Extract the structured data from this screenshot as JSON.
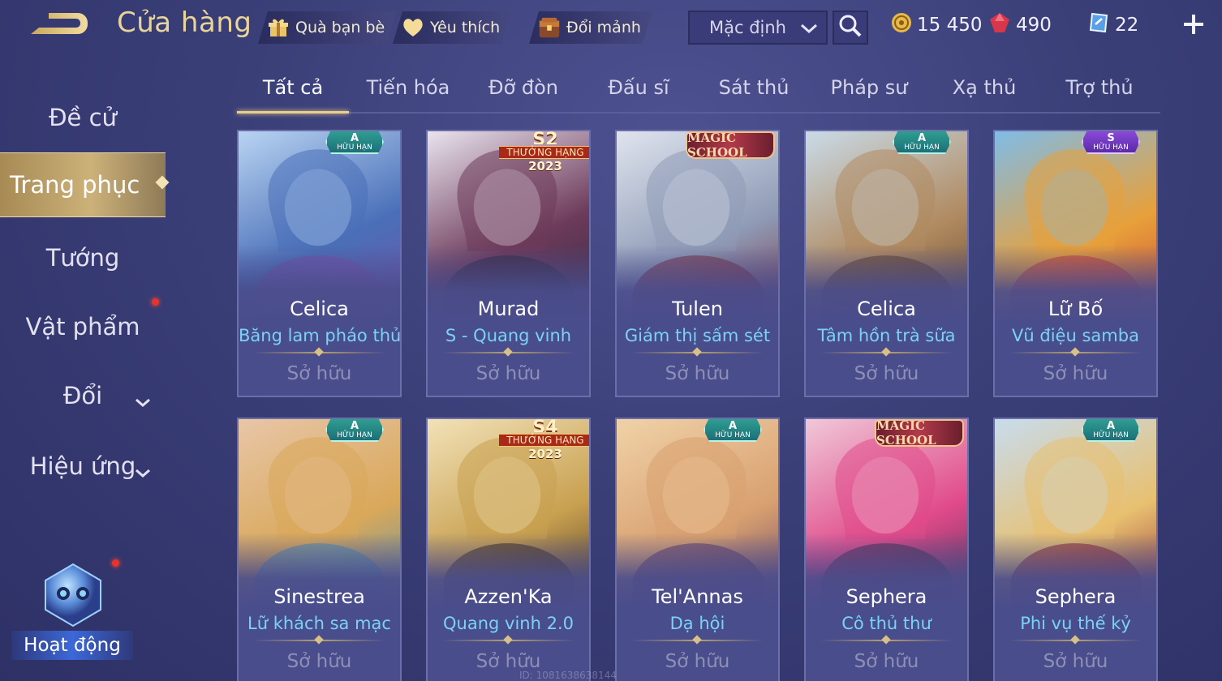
{
  "header": {
    "title": "Cửa hàng",
    "buttons": [
      {
        "label": "Quà bạn bè",
        "icon": "gift-icon"
      },
      {
        "label": "Yêu thích",
        "icon": "heart-icon"
      },
      {
        "label": "Đổi mảnh",
        "icon": "chest-icon"
      }
    ],
    "sort": {
      "value": "Mặc định"
    },
    "currencies": [
      {
        "icon": "gold-coin-icon",
        "value": "15 450"
      },
      {
        "icon": "red-gem-icon",
        "value": "490"
      },
      {
        "icon": "ticket-icon",
        "value": "22"
      }
    ]
  },
  "sidebar": {
    "items": [
      {
        "label": "Đề cử"
      },
      {
        "label": "Trang phục",
        "active": true
      },
      {
        "label": "Tướng"
      },
      {
        "label": "Vật phẩm",
        "notification": true
      },
      {
        "label": "Đổi",
        "expandable": true
      },
      {
        "label": "Hiệu ứng",
        "expandable": true
      }
    ],
    "activity": {
      "label": "Hoạt động",
      "notification": true
    }
  },
  "tabs": [
    {
      "label": "Tất cả",
      "active": true
    },
    {
      "label": "Tiến hóa"
    },
    {
      "label": "Đỡ đòn"
    },
    {
      "label": "Đấu sĩ"
    },
    {
      "label": "Sát thủ"
    },
    {
      "label": "Pháp sư"
    },
    {
      "label": "Xạ thủ"
    },
    {
      "label": "Trợ thủ"
    }
  ],
  "cards": [
    {
      "hero": "Celica",
      "skin": "Băng lam pháo thủ",
      "status": "Sở hữu",
      "tag": {
        "kind": "rank",
        "rank": "A",
        "text": "HỮU HẠN"
      },
      "palette": [
        "#b9d4f2",
        "#4a6fb8",
        "#7a4fa8"
      ]
    },
    {
      "hero": "Murad",
      "skin": "S - Quang vinh",
      "status": "Sở hữu",
      "tag": {
        "kind": "season",
        "season": "S2",
        "ribbon": "THƯỞNG HẠNG",
        "year": "2023"
      },
      "palette": [
        "#e9e4ee",
        "#6d3a5a",
        "#2b2a44"
      ]
    },
    {
      "hero": "Tulen",
      "skin": "Giám thị sấm sét",
      "status": "Sở hữu",
      "tag": {
        "kind": "event",
        "text": "MAGIC SCHOOL"
      },
      "palette": [
        "#dfe4ee",
        "#8f9bb6",
        "#7a2a3a"
      ]
    },
    {
      "hero": "Celica",
      "skin": "Tâm hồn trà sữa",
      "status": "Sở hữu",
      "tag": {
        "kind": "rank",
        "rank": "A",
        "text": "HỮU HẠN"
      },
      "palette": [
        "#c9dbe8",
        "#b08a60",
        "#5a3e2c"
      ]
    },
    {
      "hero": "Lữ Bố",
      "skin": "Vũ điệu samba",
      "status": "Sở hữu",
      "tag": {
        "kind": "rank",
        "rank": "S",
        "text": "HỮU HẠN"
      },
      "palette": [
        "#7fbce8",
        "#e8a03a",
        "#c83a3a"
      ]
    },
    {
      "hero": "Sinestrea",
      "skin": "Lữ khách sa mạc",
      "status": "Sở hữu",
      "tag": {
        "kind": "rank",
        "rank": "A",
        "text": "HỮU HẠN"
      },
      "palette": [
        "#e8c6a8",
        "#d9a85a",
        "#4a8fb8"
      ]
    },
    {
      "hero": "Azzen'Ka",
      "skin": "Quang vinh 2.0",
      "status": "Sở hữu",
      "tag": {
        "kind": "season",
        "season": "S4",
        "ribbon": "THƯỞNG HẠNG",
        "year": "2023"
      },
      "palette": [
        "#f2e2b8",
        "#c8a050",
        "#3a2a20"
      ]
    },
    {
      "hero": "Tel'Annas",
      "skin": "Dạ hội",
      "status": "Sở hữu",
      "tag": {
        "kind": "rank",
        "rank": "A",
        "text": "HỮU HẠN"
      },
      "palette": [
        "#f0d2a8",
        "#d8a070",
        "#5a3a6a"
      ]
    },
    {
      "hero": "Sephera",
      "skin": "Cô thủ thư",
      "status": "Sở hữu",
      "tag": {
        "kind": "event",
        "text": "MAGIC SCHOOL"
      },
      "palette": [
        "#f0c8d8",
        "#e04a8a",
        "#3a3050"
      ]
    },
    {
      "hero": "Sephera",
      "skin": "Phi vụ thế kỷ",
      "status": "Sở hữu",
      "tag": {
        "kind": "rank",
        "rank": "A",
        "text": "HỮU HẠN"
      },
      "palette": [
        "#c8dcee",
        "#e8c070",
        "#8a2030"
      ]
    }
  ],
  "watermark": "ID: 1081638638144"
}
